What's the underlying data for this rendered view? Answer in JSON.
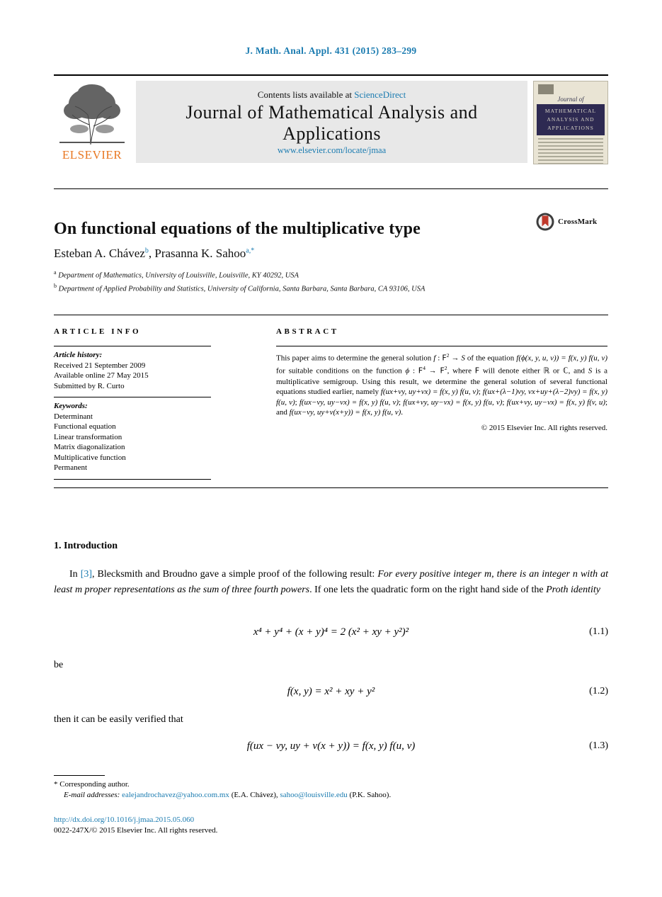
{
  "running_head": "J. Math. Anal. Appl. 431 (2015) 283–299",
  "masthead": {
    "contents_prefix": "Contents lists available at ",
    "sciencedirect": "ScienceDirect",
    "journal_title": "Journal of Mathematical Analysis and Applications",
    "journal_url": "www.elsevier.com/locate/jmaa",
    "publisher": "ELSEVIER",
    "cover": {
      "script": "Journal of",
      "band_line1": "MATHEMATICAL",
      "band_line2": "ANALYSIS AND",
      "band_line3": "APPLICATIONS"
    }
  },
  "title": "On functional equations of the multiplicative type",
  "crossmark": {
    "label": "CrossMark"
  },
  "authors": {
    "name1": "Esteban A. Chávez",
    "sup1": "b",
    "separator": ", ",
    "name2": "Prasanna K. Sahoo",
    "sup2": "a,*"
  },
  "affiliations": [
    {
      "marker": "a",
      "text": "Department of Mathematics, University of Louisville, Louisville, KY 40292, USA"
    },
    {
      "marker": "b",
      "text": "Department of Applied Probability and Statistics, University of California, Santa Barbara, Santa Barbara, CA 93106, USA"
    }
  ],
  "columns": {
    "info_heading": "ARTICLE INFO",
    "abstract_heading": "ABSTRACT"
  },
  "article_history": {
    "label": "Article history:",
    "lines": [
      "Received 21 September 2009",
      "Available online 27 May 2015",
      "Submitted by R. Curto"
    ]
  },
  "keywords": {
    "label": "Keywords:",
    "items": [
      "Determinant",
      "Functional equation",
      "Linear transformation",
      "Matrix diagonalization",
      "Multiplicative function",
      "Permanent"
    ]
  },
  "abstract": {
    "t1": "This paper aims to determine the general solution ",
    "f1": "f",
    "t2": " : ",
    "F1": "F",
    "e1": "2",
    "t3": " → ",
    "S1": "S",
    "t4": " of the equation ",
    "eq1": "f(ϕ(x, y, u, v)) = f(x, y) f(u, v)",
    "t5": " for suitable conditions on the function ",
    "phi": "ϕ",
    "t6": " : ",
    "F2": "F",
    "e2": "4",
    "t7": " → ",
    "F3": "F",
    "e3": "2",
    "t8": ", where ",
    "F4": "F",
    "t9": " will denote either ",
    "R": "ℝ",
    "t10": " or ",
    "C": "ℂ",
    "t11": ", and ",
    "S2": "S",
    "t12": " is a multiplicative semigroup. Using this result, we determine the general solution of several functional equations studied earlier, namely ",
    "eq2": "f(ux+vy, uy+vx) = f(x, y) f(u, v)",
    "semi1": "; ",
    "eq3": "f(ux+(λ−1)vy, vx+uy+(λ−2)vy) = f(x, y) f(u, v)",
    "semi2": "; ",
    "eq4": "f(ux−vy, uy−vx) = f(x, y) f(u, v)",
    "semi3": "; ",
    "eq5": "f(ux+vy, uy−vx) = f(x, y) f(u, v)",
    "semi4": "; ",
    "eq6": "f(ux+vy, uy−vx) = f(x, y) f(v, u)",
    "and": "; and ",
    "eq7": "f(ux−vy, uy+v(x+y)) = f(x, y) f(u, v)",
    "period": ".",
    "copyright": "© 2015 Elsevier Inc. All rights reserved."
  },
  "body": {
    "section_title": "1. Introduction",
    "para1_a": "In ",
    "para1_ref": "[3]",
    "para1_b": ", Blecksmith and Broudno gave a simple proof of the following result: ",
    "para1_it1": "For every positive integer m, there is an integer n with at least m proper representations as the sum of three fourth powers",
    "para1_c": ". If one lets the quadratic form on the right hand side of the ",
    "para1_it2": "Proth identity",
    "eq11_text": "x⁴ + y⁴ + (x + y)⁴ = 2 (x² + xy + y²)²",
    "eq11_num": "(1.1)",
    "between1": "be",
    "eq12_text": "f(x, y) = x² + xy + y²",
    "eq12_num": "(1.2)",
    "between2": "then it can be easily verified that",
    "eq13_text": "f(ux − vy, uy + v(x + y)) = f(x, y) f(u, v)",
    "eq13_num": "(1.3)"
  },
  "footer": {
    "star": "*",
    "corresponding": "Corresponding author.",
    "email_label": "E-mail addresses:",
    "email1": "ealejandrochavez@yahoo.com.mx",
    "email1_owner": "(E.A. Chávez)",
    "email_sep": ", ",
    "email2": "sahoo@louisville.edu",
    "email2_owner": "(P.K. Sahoo).",
    "doi": "http://dx.doi.org/10.1016/j.jmaa.2015.05.060",
    "issn_line": "0022-247X/© 2015 Elsevier Inc. All rights reserved."
  },
  "colors": {
    "link": "#1a7bb0",
    "elsevier_orange": "#e87722",
    "masthead_grey": "#e8e8e8",
    "cover_navy": "#2e2a52",
    "crossmark_red": "#c0392b"
  }
}
